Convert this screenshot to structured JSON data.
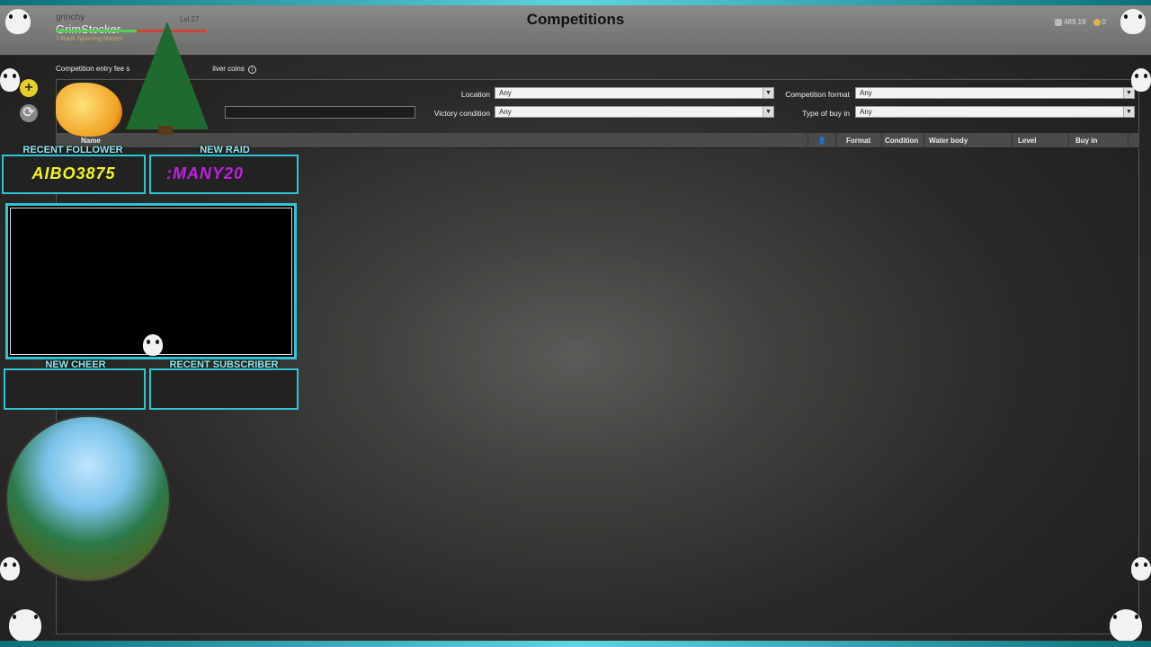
{
  "header": {
    "title": "Competitions",
    "player_small": "grinchy",
    "player_name": "GrimStocker",
    "player_rank": "J Rank Spinning Master",
    "level": "Lvl 27",
    "silver": "489.18",
    "gold": "0"
  },
  "filters": {
    "fee_note": "Competition entry fee s",
    "fee_note_tail": "ilver coins",
    "location_label": "Location",
    "location_value": "Any",
    "format_label": "Competition format",
    "format_value": "Any",
    "victory_label": "Victory condition",
    "victory_value": "Any",
    "buyin_label": "Type of buy in",
    "buyin_value": "Any"
  },
  "table": {
    "name": "Name",
    "format": "Format",
    "condition": "Condition",
    "water_body": "Water body",
    "level": "Level",
    "buy_in": "Buy in"
  },
  "overlay": {
    "recent_follower_label": "RECENT FOLLOWER",
    "recent_follower": "AIBO3875",
    "new_raid_label": "NEW RAID",
    "new_raid": ":MANY20",
    "new_cheer_label": "NEW CHEER",
    "recent_subscriber_label": "RECENT SUBSCRIBER"
  },
  "colors": {
    "accent": "#2cc6d6",
    "follower_text": "#f3f32a",
    "raid_text": "#c020e0"
  }
}
